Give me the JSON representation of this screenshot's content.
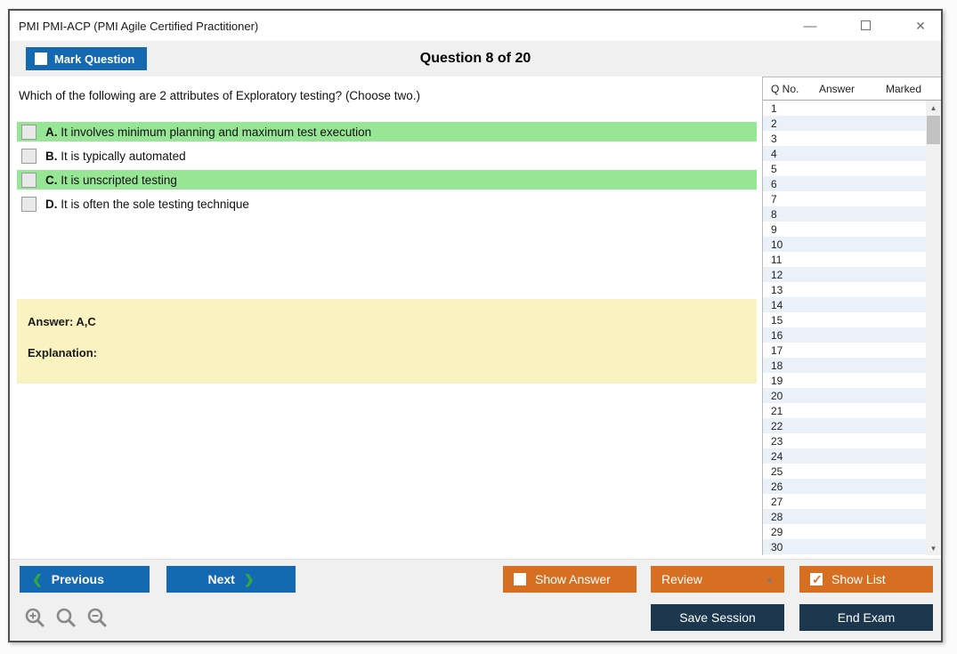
{
  "window": {
    "title": "PMI PMI-ACP (PMI Agile Certified Practitioner)",
    "icons": {
      "minimize": "—",
      "close": "✕"
    }
  },
  "header": {
    "mark_question_label": "Mark Question",
    "question_counter": "Question 8 of 20"
  },
  "question": {
    "text": "Which of the following are 2 attributes of Exploratory testing? (Choose two.)",
    "options": [
      {
        "letter": "A.",
        "text": "It involves minimum planning and maximum test execution",
        "highlighted": true
      },
      {
        "letter": "B.",
        "text": "It is typically automated",
        "highlighted": false
      },
      {
        "letter": "C.",
        "text": "It is unscripted testing",
        "highlighted": true
      },
      {
        "letter": "D.",
        "text": "It is often the sole testing technique",
        "highlighted": false
      }
    ],
    "answer_label": "Answer: A,C",
    "explanation_label": "Explanation:"
  },
  "question_list": {
    "columns": [
      "Q No.",
      "Answer",
      "Marked"
    ],
    "rows": [
      "1",
      "2",
      "3",
      "4",
      "5",
      "6",
      "7",
      "8",
      "9",
      "10",
      "11",
      "12",
      "13",
      "14",
      "15",
      "16",
      "17",
      "18",
      "19",
      "20",
      "21",
      "22",
      "23",
      "24",
      "25",
      "26",
      "27",
      "28",
      "29",
      "30"
    ],
    "scroll_icons": {
      "up": "▲",
      "down": "▼"
    }
  },
  "footer": {
    "previous_label": "Previous",
    "next_label": "Next",
    "show_answer_label": "Show Answer",
    "review_label": "Review",
    "show_list_label": "Show List",
    "save_session_label": "Save Session",
    "end_exam_label": "End Exam",
    "chevron_left": "❮",
    "chevron_right": "❯",
    "review_arrow": "▲"
  },
  "colors": {
    "blue_button": "#1569b3",
    "orange_button": "#d76f22",
    "navy_button": "#1d384e",
    "highlight_green": "#96e696",
    "answer_box_yellow": "#faf2c0",
    "row_stripe_blue": "#eaf1f8"
  }
}
